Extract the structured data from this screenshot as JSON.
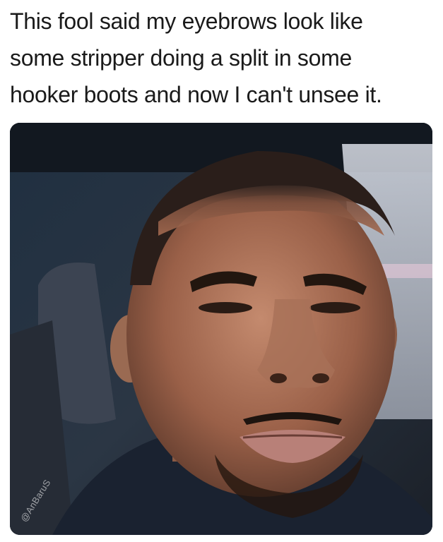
{
  "caption": {
    "lines": [
      "This fool said my eyebrows look like",
      "some stripper doing a split in some",
      "hooker boots and now I can't unsee it."
    ]
  },
  "photo": {
    "watermark": "@AnBaruS"
  }
}
